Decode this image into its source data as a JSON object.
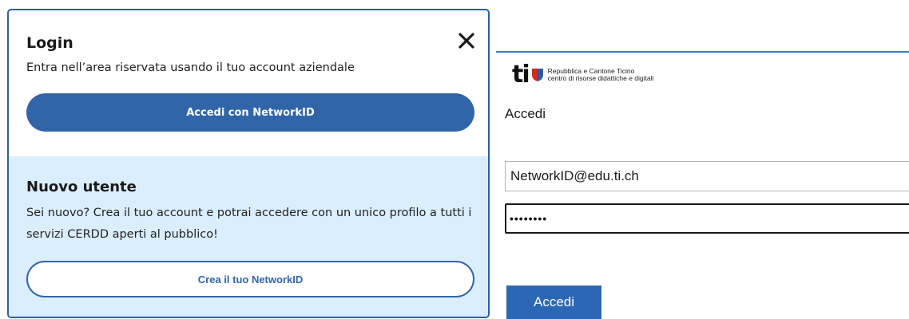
{
  "login_modal": {
    "title": "Login",
    "description": "Entra nell’area riservata usando il tuo account aziendale",
    "primary_button": "Accedi con NetworkID",
    "close_icon": "close-icon",
    "new_user": {
      "title": "Nuovo utente",
      "description": "Sei nuovo? Crea il tuo account e potrai accedere con un unico profilo a tutti i servizi CERDD aperti al pubblico!",
      "button": "Crea il tuo NetworkID"
    }
  },
  "signin_panel": {
    "logo": {
      "mark": "ti",
      "line1": "Repubblica e Cantone Ticino",
      "line2": "centro di risorse didattiche e digitali"
    },
    "title": "Accedi",
    "email_value": "NetworkID@edu.ti.ch",
    "password_value": "••••••••",
    "submit_button": "Accedi"
  },
  "colors": {
    "primary": "#3265a8",
    "new_user_bg": "#dbeefd",
    "signin_button": "#2b67b3",
    "shield_blue": "#2b5cab",
    "shield_red": "#d52b1e"
  }
}
